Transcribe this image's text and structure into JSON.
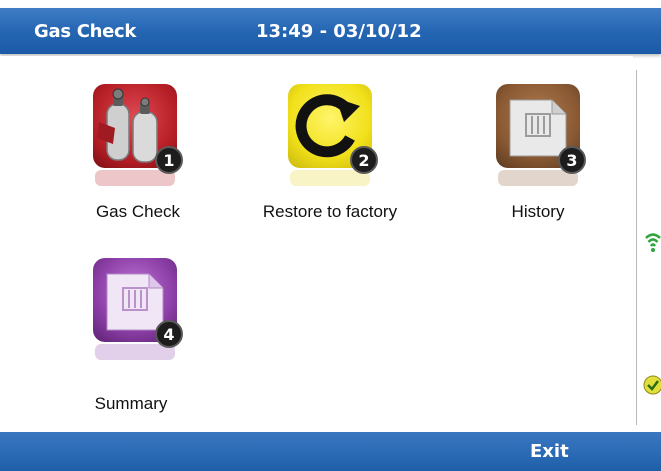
{
  "header": {
    "title": "Gas Check",
    "datetime": "13:49 - 03/10/12"
  },
  "tiles": [
    {
      "label": "Gas Check",
      "badge": "1",
      "icon": "gas-cylinders-icon",
      "color": "#c8262e"
    },
    {
      "label": "Restore to factory",
      "badge": "2",
      "icon": "restore-icon",
      "color": "#f4e51b"
    },
    {
      "label": "History",
      "badge": "3",
      "icon": "history-icon",
      "color": "#8a5a34"
    },
    {
      "label": "Summary",
      "badge": "4",
      "icon": "summary-icon",
      "color": "#8b3ea6"
    }
  ],
  "footer": {
    "exit_label": "Exit"
  },
  "status": {
    "wifi_icon": "wifi-icon",
    "check_icon": "check-icon"
  },
  "colors": {
    "header": "#2566b3",
    "footer": "#1f5faa"
  }
}
